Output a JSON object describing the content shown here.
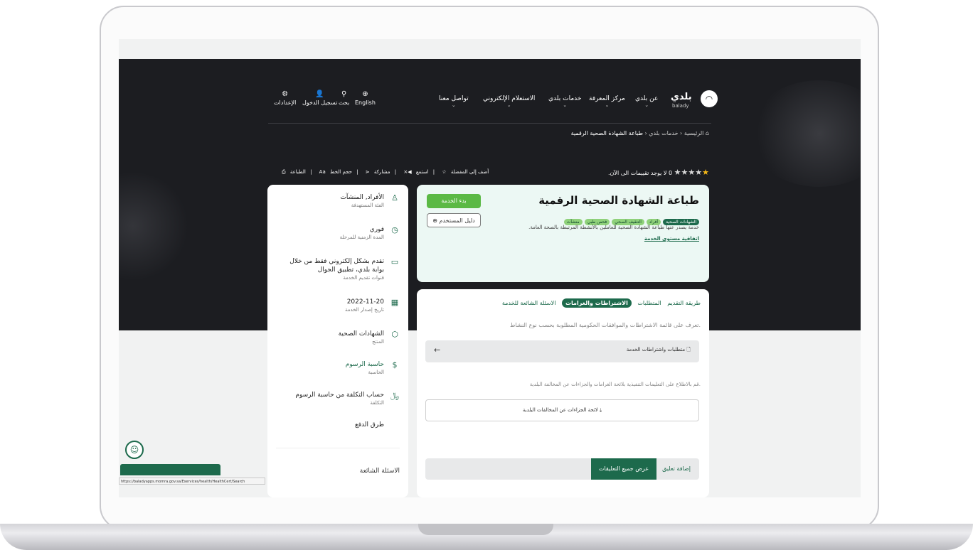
{
  "nav": {
    "logo_ar": "بلدي",
    "logo_en": "balady",
    "items": [
      "عن بلدي",
      "مركز المعرفة",
      "خدمات بلدي",
      "الاستعلام الإلكتروني",
      "تواصل معنا"
    ],
    "english": "English",
    "search": "بحث",
    "login": "تسجيل الدخول",
    "settings": "الإعدادات"
  },
  "breadcrumb": {
    "home": "الرئيسية",
    "services": "خدمات بلدي",
    "current": "طباعة الشهادة الصحية الرقمية"
  },
  "rating": {
    "stars": 5,
    "count": "0",
    "text": "لا يوجد تقييمات الى الآن."
  },
  "toolbar": {
    "favorite": "أضف إلى المفضلة",
    "listen": "استمع",
    "share": "مشاركة",
    "font_size": "حجم الخط",
    "print": "الطباعة"
  },
  "hero": {
    "title": "طباعة الشهادة الصحية الرقمية",
    "tags": [
      "الشهادات الصحية",
      "أفراد",
      "التثقيف الصحي",
      "فحص طبي",
      "منشآت"
    ],
    "description": "خدمة يصدر عنها طباعة الشهادة الصحية للعاملين بالأنشطة المرتبطة بالصحة العامة.",
    "sla": "اتفاقية مستوى الخدمة",
    "start_button": "بدء الخدمة",
    "guide_button": "دليل المستخدم"
  },
  "tabs": [
    "طريقة التقديم",
    "المتطلبات",
    "الاشتراطات والغرامات",
    "الاسئلة الشائعة للخدمة"
  ],
  "active_tab": "الاشتراطات والغرامات",
  "main": {
    "intro": "تعرف على قائمة الاشتراطات والموافقات الحكومية المطلوبة بحسب نوع النشاط.",
    "requirements_label": "متطلبات واشتراطات الخدمة",
    "note": "قم بالاطلاع على التعليمات التنفيذية بلائحة الغرامات والجزاءات عن المخالفة البلدية.",
    "download_label": "لائحة الجزاءات عن المخالفات البلدية",
    "add_comment": "إضافة تعليق",
    "show_comments": "عرض جميع التعليقات"
  },
  "sidebar": {
    "items": [
      {
        "title": "الأفراد, المنشآت",
        "sub": "الفئة المستهدفة"
      },
      {
        "title": "فوري",
        "sub": "المدة الزمنية للمرحلة"
      },
      {
        "title": "تقدم بشكل إلكتروني فقط من خلال بوابة بلدي، تطبيق الجوال",
        "sub": "قنوات تقديم الخدمة"
      },
      {
        "title": "2022-11-20",
        "sub": "تاريخ إصدار الخدمة"
      },
      {
        "title": "الشهادات الصحية",
        "sub": "المنتج"
      },
      {
        "title": "حاسبة الرسوم",
        "sub": "الحاسبة"
      },
      {
        "title": "حساب التكلفة من حاسبة الرسوم",
        "sub": "التكلفة"
      }
    ],
    "payment": "طرق الدفع",
    "faq": "الاسئلة الشائعة"
  },
  "status_url": "https://baladyapps.momra.gov.sa/Eservices/health/HealthCert/Search",
  "colors": {
    "brand": "#1d6a4c",
    "start": "#5bb945",
    "dark_bg": "#1c1d21",
    "hero_bg": "#ecf8f4"
  }
}
